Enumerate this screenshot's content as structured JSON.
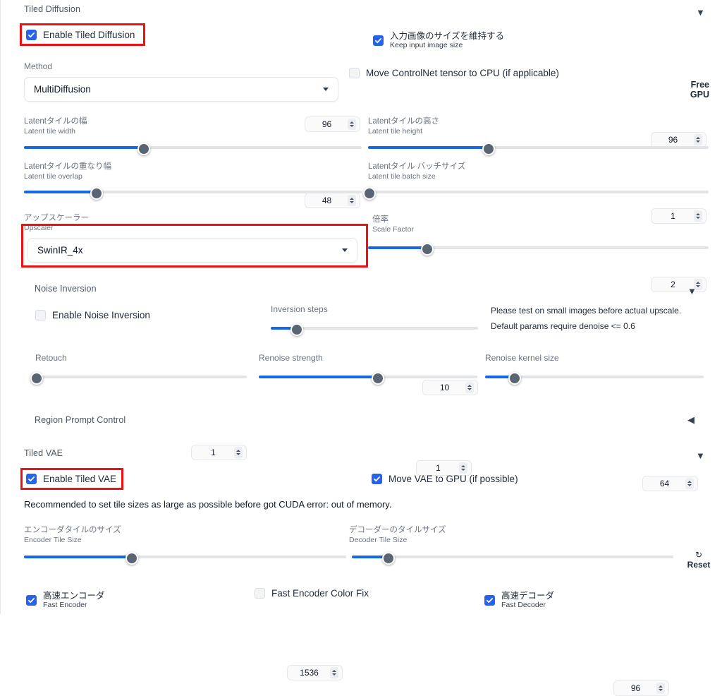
{
  "sections": {
    "tiled_diffusion": {
      "title": "Tiled Diffusion",
      "arrow": "chevron-down-icon",
      "enable": {
        "label": "Enable Tiled Diffusion",
        "checked": true
      },
      "keep_input_size": {
        "jp": "入力画像のサイズを維持する",
        "en": "Keep input image size",
        "checked": true
      },
      "move_controlnet": {
        "label": "Move ControlNet tensor to CPU (if applicable)",
        "checked": false
      },
      "free_gpu": {
        "line1": "Free",
        "line2": "GPU"
      },
      "method": {
        "label": "Method",
        "value": "MultiDiffusion"
      },
      "upscaler": {
        "jp": "アップスケーラー",
        "en": "Upscaler",
        "value": "SwinIR_4x"
      }
    },
    "noise_inversion": {
      "title": "Noise Inversion",
      "arrow": "chevron-down-icon",
      "enable": {
        "label": "Enable Noise Inversion",
        "checked": false
      },
      "hint_line1": "Please test on small images before actual upscale.",
      "hint_line2": "Default params require denoise <= 0.6"
    },
    "region_prompt_control": {
      "title": "Region Prompt Control",
      "arrow": "chevron-left-icon"
    },
    "tiled_vae": {
      "title": "Tiled VAE",
      "arrow": "chevron-down-icon",
      "enable": {
        "label": "Enable Tiled VAE",
        "checked": true
      },
      "move_vae": {
        "label": "Move VAE to GPU (if possible)",
        "checked": true
      },
      "recommend": "Recommended to set tile sizes as large as possible before got CUDA error: out of memory.",
      "fast_encoder": {
        "jp": "高速エンコーダ",
        "en": "Fast Encoder",
        "checked": true
      },
      "fast_encoder_color_fix": {
        "label": "Fast Encoder Color Fix",
        "checked": false
      },
      "fast_decoder": {
        "jp": "高速デコーダ",
        "en": "Fast Decoder",
        "checked": true
      },
      "reset": {
        "icon": "↻",
        "label": "Reset"
      }
    }
  },
  "sliders": {
    "latent_tile_width": {
      "jp": "Latentタイルの幅",
      "en": "Latent tile width",
      "value": "96",
      "percent": 35
    },
    "latent_tile_height": {
      "jp": "Latentタイルの高さ",
      "en": "Latent tile height",
      "value": "96",
      "percent": 35
    },
    "latent_tile_overlap": {
      "jp": "Latentタイルの重なり幅",
      "en": "Latent tile overlap",
      "value": "48",
      "percent": 21
    },
    "latent_tile_batch": {
      "jp": "Latentタイル バッチサイズ",
      "en": "Latent tile batch size",
      "value": "1",
      "percent": 0
    },
    "scale_factor": {
      "jp": "倍率",
      "en": "Scale Factor",
      "value": "2",
      "percent": 17
    },
    "inversion_steps": {
      "label": "Inversion steps",
      "value": "10",
      "percent": 12
    },
    "retouch": {
      "label": "Retouch",
      "value": "1",
      "percent": 0
    },
    "renoise_strength": {
      "label": "Renoise strength",
      "value": "1",
      "percent": 54
    },
    "renoise_kernel": {
      "label": "Renoise kernel size",
      "value": "64",
      "percent": 13
    },
    "encoder_tile_size": {
      "jp": "エンコーダタイルのサイズ",
      "en": "Encoder Tile Size",
      "value": "1536",
      "percent": 33
    },
    "decoder_tile_size": {
      "jp": "デコーダーのタイルサイズ",
      "en": "Decoder Tile Size",
      "value": "96",
      "percent": 11
    }
  },
  "colors": {
    "accent": "#1667e8",
    "checkbox_on": "#2563eb",
    "highlight": "#ee1111",
    "thumb": "#5b6473",
    "track": "#e2e4e7"
  }
}
